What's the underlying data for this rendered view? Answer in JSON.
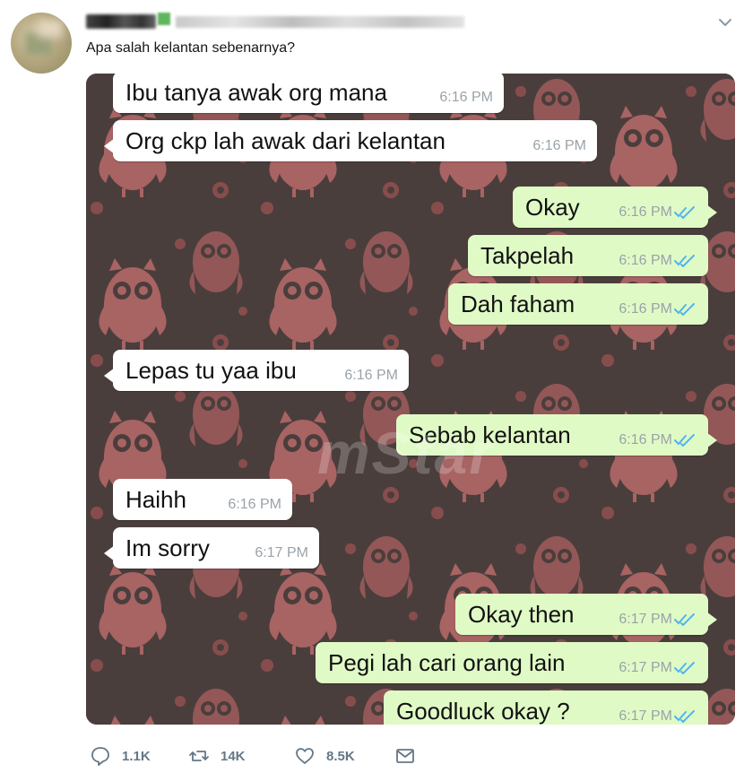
{
  "tweet": {
    "text": "Apa salah kelantan sebenarnya?"
  },
  "chat": {
    "watermark": "mStar",
    "messages": [
      {
        "dir": "in",
        "text": "Ibu tanya awak org mana",
        "time": "6:16 PM"
      },
      {
        "dir": "in",
        "text": "Org ckp lah awak dari kelantan",
        "time": "6:16 PM"
      },
      {
        "dir": "out",
        "text": "Okay",
        "time": "6:16 PM"
      },
      {
        "dir": "out",
        "text": "Takpelah",
        "time": "6:16 PM"
      },
      {
        "dir": "out",
        "text": "Dah faham",
        "time": "6:16 PM"
      },
      {
        "dir": "in",
        "text": "Lepas tu yaa ibu",
        "time": "6:16 PM"
      },
      {
        "dir": "out",
        "text": "Sebab kelantan",
        "time": "6:16 PM"
      },
      {
        "dir": "in",
        "text": "Haihh",
        "time": "6:16 PM"
      },
      {
        "dir": "in",
        "text": "Im sorry",
        "time": "6:17 PM"
      },
      {
        "dir": "out",
        "text": "Okay then",
        "time": "6:17 PM"
      },
      {
        "dir": "out",
        "text": "Pegi lah cari orang lain",
        "time": "6:17 PM"
      },
      {
        "dir": "out",
        "text": "Goodluck okay ?",
        "time": "6:17 PM"
      }
    ]
  },
  "actions": {
    "reply_count": "1.1K",
    "retweet_count": "14K",
    "like_count": "8.5K"
  },
  "colors": {
    "incoming_bubble": "#ffffff",
    "outgoing_bubble": "#e0fac6",
    "read_ticks": "#4fb6ec",
    "timestamp": "#9aa3a8",
    "chat_wallpaper": "#4a3e3c",
    "owl_pattern": "#b96a6a",
    "action_icons": "#657786"
  },
  "icons": [
    "caret-down-icon",
    "reply-icon",
    "retweet-icon",
    "like-icon",
    "direct-message-icon",
    "double-check-icon",
    "owl-pattern"
  ]
}
